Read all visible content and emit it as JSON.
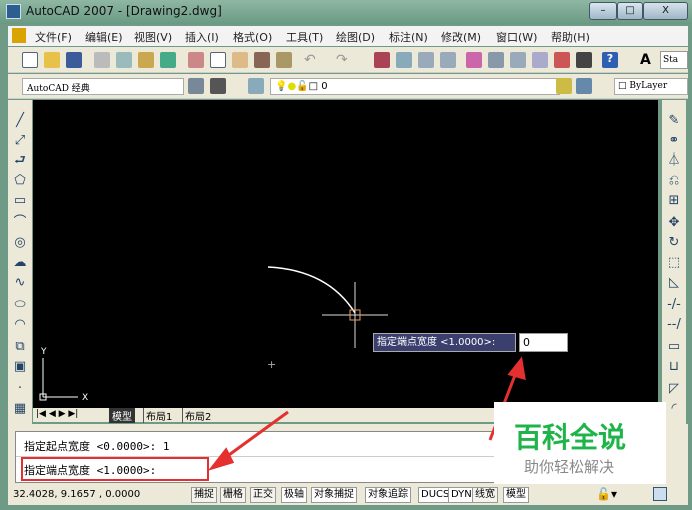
{
  "window": {
    "title": "AutoCAD 2007 - [Drawing2.dwg]",
    "min": "–",
    "max": "□",
    "close": "X"
  },
  "menu": [
    "文件(F)",
    "编辑(E)",
    "视图(V)",
    "插入(I)",
    "格式(O)",
    "工具(T)",
    "绘图(D)",
    "标注(N)",
    "修改(M)",
    "窗口(W)",
    "帮助(H)"
  ],
  "toolbar2": {
    "workspace": "AutoCAD 经典",
    "layer": "0",
    "color": "ByLayer",
    "style": "Sta"
  },
  "tabs": [
    "模型",
    "布局1",
    "布局2"
  ],
  "ucs": {
    "y": "Y",
    "x": "X"
  },
  "dynamic_input": {
    "prompt": "指定端点宽度 <1.0000>:",
    "value": "0"
  },
  "command": {
    "line1": "指定起点宽度 <0.0000>: 1",
    "line2": "指定端点宽度 <1.0000>:"
  },
  "status": {
    "coords": "32.4028, 9.1657 , 0.0000",
    "buttons": [
      "捕捉",
      "栅格",
      "正交",
      "极轴",
      "对象捕捉",
      "对象追踪",
      "DUCS",
      "DYN",
      "线宽",
      "模型"
    ]
  },
  "watermark": {
    "title": "百科全说",
    "subtitle": "助你轻松解决"
  }
}
